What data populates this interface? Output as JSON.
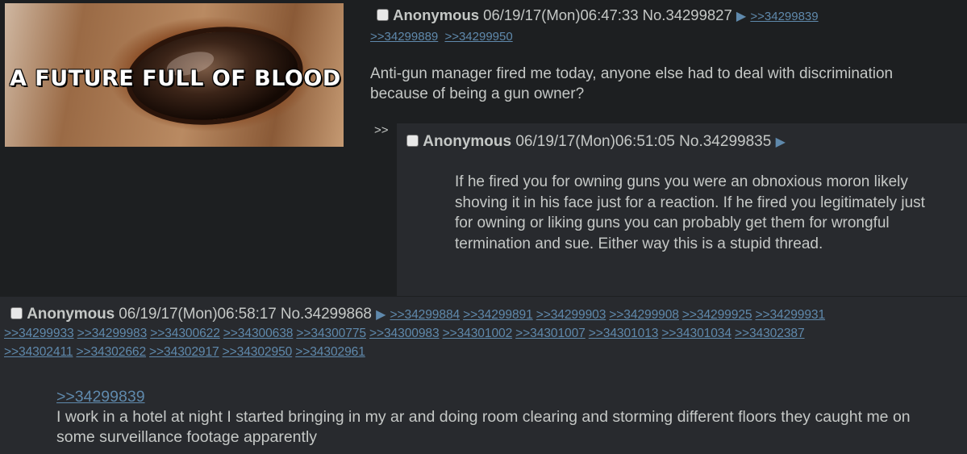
{
  "op": {
    "thumbnail_caption": "A FUTURE FULL OF BLOOD",
    "name": "Anonymous",
    "datetime": "06/19/17(Mon)06:47:33",
    "post_no": "No.34299827",
    "replies": [
      ">>34299839",
      ">>34299889",
      ">>34299950"
    ],
    "message": "Anti-gun manager fired me today, anyone else had to deal with discrimination because of being a gun owner?"
  },
  "reply1": {
    "marker": ">>",
    "name": "Anonymous",
    "datetime": "06/19/17(Mon)06:51:05",
    "post_no": "No.34299835",
    "message": "If he fired you for owning guns you were an obnoxious moron likely shoving it in his face just for a reaction. If he fired you legitimately just for owning or liking guns you can probably get them for wrongful termination and sue. Either way this is a stupid thread."
  },
  "reply2": {
    "name": "Anonymous",
    "datetime": "06/19/17(Mon)06:58:17",
    "post_no": "No.34299868",
    "replies": [
      ">>34299884",
      ">>34299891",
      ">>34299903",
      ">>34299908",
      ">>34299925",
      ">>34299931",
      ">>34299933",
      ">>34299983",
      ">>34300622",
      ">>34300638",
      ">>34300775",
      ">>34300983",
      ">>34301002",
      ">>34301007",
      ">>34301013",
      ">>34301034",
      ">>34302387",
      ">>34302411",
      ">>34302662",
      ">>34302917",
      ">>34302950",
      ">>34302961"
    ],
    "quote_link": ">>34299839",
    "message": "I work in a hotel at night I started bringing in my ar and doing room clearing and storming different floors they caught me on some surveillance footage apparently"
  },
  "icons": {
    "checkbox": "post-select-checkbox-icon",
    "arrow": "post-menu-arrow-icon"
  },
  "colors": {
    "background": "#1d1f21",
    "reply_background": "#282a2e",
    "text": "#c5c8c6",
    "link": "#5f89ac"
  }
}
